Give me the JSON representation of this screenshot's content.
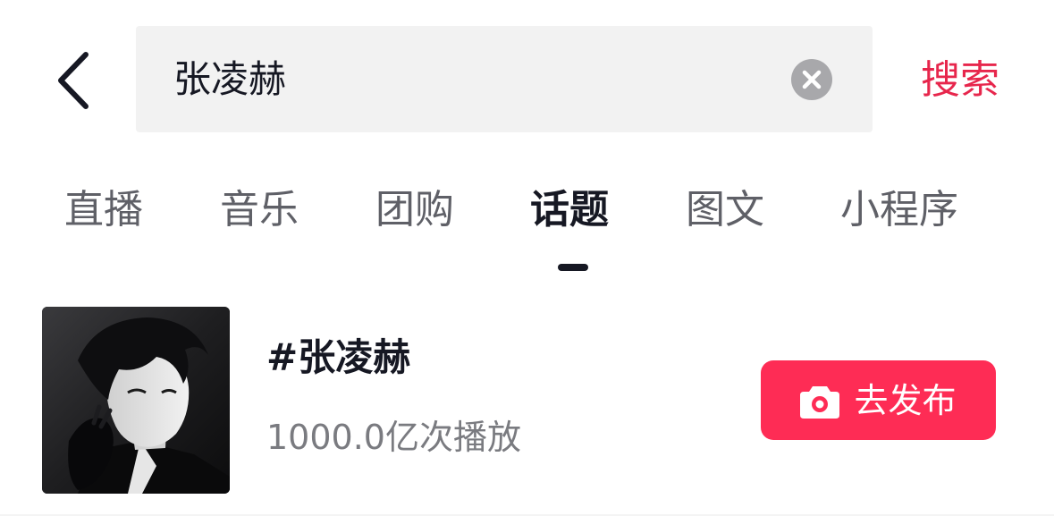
{
  "search": {
    "query": "张凌赫",
    "submit_label": "搜索"
  },
  "tabs": [
    {
      "label": "直播",
      "active": false
    },
    {
      "label": "音乐",
      "active": false
    },
    {
      "label": "团购",
      "active": false
    },
    {
      "label": "话题",
      "active": true
    },
    {
      "label": "图文",
      "active": false
    },
    {
      "label": "小程序",
      "active": false
    }
  ],
  "result": {
    "title": "#张凌赫",
    "stats": "1000.0亿次播放",
    "action_label": "去发布",
    "action_icon": "camera-icon"
  },
  "colors": {
    "accent": "#fe2c55",
    "search_text": "#e7264c",
    "primary_text": "#161823",
    "secondary_text": "#7a7b80"
  }
}
